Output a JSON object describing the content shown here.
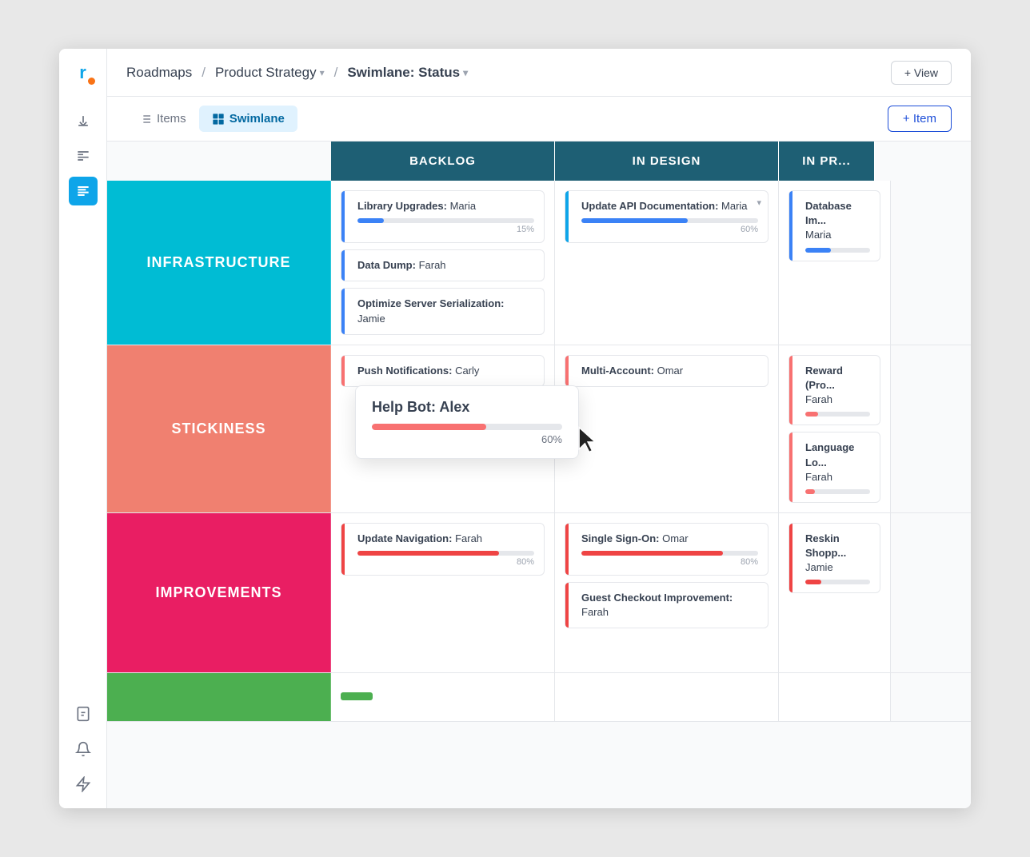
{
  "app": {
    "logo_text": "r",
    "logo_dot": true
  },
  "breadcrumb": {
    "roadmaps": "Roadmaps",
    "sep1": "/",
    "product_strategy": "Product Strategy",
    "sep2": "/",
    "swimlane_status": "Swimlane: Status"
  },
  "toolbar": {
    "add_view_label": "+ View",
    "items_tab": "Items",
    "swimlane_tab": "Swimlane",
    "add_item_label": "+ Item"
  },
  "columns": {
    "backlog": "BACKLOG",
    "in_design": "IN DESIGN",
    "in_progress": "IN PR..."
  },
  "swimlanes": [
    {
      "name": "INFRASTRUCTURE",
      "color": "infra",
      "backlog": [
        {
          "title": "Library Upgrades:",
          "assignee": "Maria",
          "progress": 15,
          "bar_color": "blue"
        },
        {
          "title": "Data Dump:",
          "assignee": "Farah",
          "progress": null,
          "bar_color": null
        },
        {
          "title": "Optimize Server Serialization:",
          "assignee": "Jamie",
          "progress": null,
          "bar_color": null
        }
      ],
      "in_design": [
        {
          "title": "Update API Documentation:",
          "assignee": "Maria",
          "progress": 60,
          "bar_color": "blue",
          "dropdown": true
        }
      ],
      "in_progress": [
        {
          "title": "Database Im...",
          "assignee": "Maria",
          "progress": null,
          "bar_color": "blue",
          "partial": true
        }
      ]
    },
    {
      "name": "STICKINESS",
      "color": "sticky",
      "backlog": [
        {
          "title": "Push Notifications:",
          "assignee": "Carly",
          "progress": null,
          "bar_color": "salmon"
        }
      ],
      "in_design": [
        {
          "title": "Multi-Account:",
          "assignee": "Omar",
          "progress": null,
          "bar_color": "salmon"
        }
      ],
      "in_progress": [
        {
          "title": "Reward (Pro...",
          "assignee": "Farah",
          "progress": null,
          "bar_color": "salmon",
          "partial": true
        },
        {
          "title": "Language Lo...",
          "assignee": "Farah",
          "progress": null,
          "bar_color": "salmon",
          "partial": true
        }
      ]
    },
    {
      "name": "IMPROVEMENTS",
      "color": "improve",
      "backlog": [
        {
          "title": "Update Navigation:",
          "assignee": "Farah",
          "progress": 80,
          "bar_color": "red"
        }
      ],
      "in_design": [
        {
          "title": "Single Sign-On:",
          "assignee": "Omar",
          "progress": 80,
          "bar_color": "red"
        },
        {
          "title": "Guest Checkout Improvement:",
          "assignee": "Farah",
          "progress": null,
          "bar_color": "red"
        }
      ],
      "in_progress": [
        {
          "title": "Reskin Shopp...",
          "assignee": "Jamie",
          "progress": null,
          "bar_color": "red",
          "partial": true
        }
      ]
    }
  ],
  "tooltip": {
    "title": "Help Bot:",
    "assignee": "Alex",
    "progress": 60
  },
  "sidebar": {
    "icons": [
      {
        "name": "download-icon",
        "symbol": "⬇",
        "active": false
      },
      {
        "name": "list-icon",
        "symbol": "≡",
        "active": false
      },
      {
        "name": "roadmap-icon",
        "symbol": "☰",
        "active": true
      },
      {
        "name": "contacts-icon",
        "symbol": "👤",
        "active": false
      },
      {
        "name": "bell-icon",
        "symbol": "🔔",
        "active": false
      },
      {
        "name": "lightning-icon",
        "symbol": "⚡",
        "active": false
      }
    ]
  }
}
